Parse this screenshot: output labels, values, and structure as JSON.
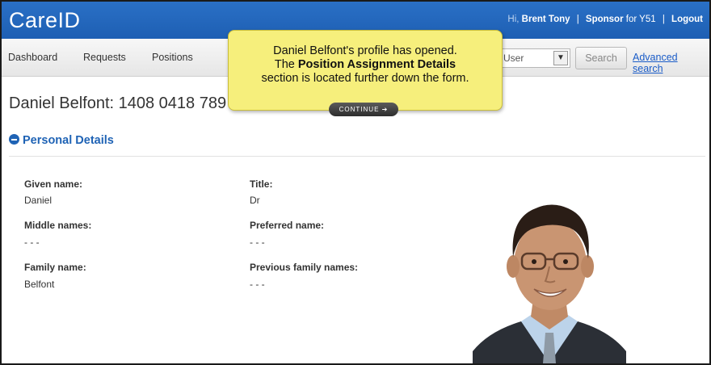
{
  "app": {
    "logo": "CareID"
  },
  "userbar": {
    "greeting": "Hi,",
    "user_name": "Brent Tony",
    "sponsor_prefix": "Sponsor",
    "sponsor_for": "for Y51",
    "separator": "|",
    "logout": "Logout"
  },
  "nav": {
    "items": [
      {
        "label": "Dashboard"
      },
      {
        "label": "Requests"
      },
      {
        "label": "Positions"
      }
    ],
    "search_type_selected": "User",
    "search_button": "Search",
    "advanced_search": "Advanced search"
  },
  "page": {
    "title": "Daniel Belfont: 1408 0418 789"
  },
  "personal_details": {
    "heading": "Personal Details",
    "fields": {
      "given_name": {
        "label": "Given name:",
        "value": "Daniel"
      },
      "title": {
        "label": "Title:",
        "value": "Dr"
      },
      "middle_names": {
        "label": "Middle names:",
        "value": "- - -"
      },
      "preferred_name": {
        "label": "Preferred name:",
        "value": "- - -"
      },
      "family_name": {
        "label": "Family name:",
        "value": "Belfont"
      },
      "previous_family_names": {
        "label": "Previous family names:",
        "value": "- - -"
      }
    }
  },
  "callout": {
    "line1": "Daniel Belfont's profile has opened.",
    "line2_prefix": "The ",
    "line2_bold": "Position Assignment Details",
    "line3": "section is located further down the form.",
    "continue": "CONTINUE ➔"
  },
  "colors": {
    "header_blue": "#1e5fb3",
    "link_blue": "#1a5cc8",
    "callout_yellow": "#f6ef7c"
  }
}
